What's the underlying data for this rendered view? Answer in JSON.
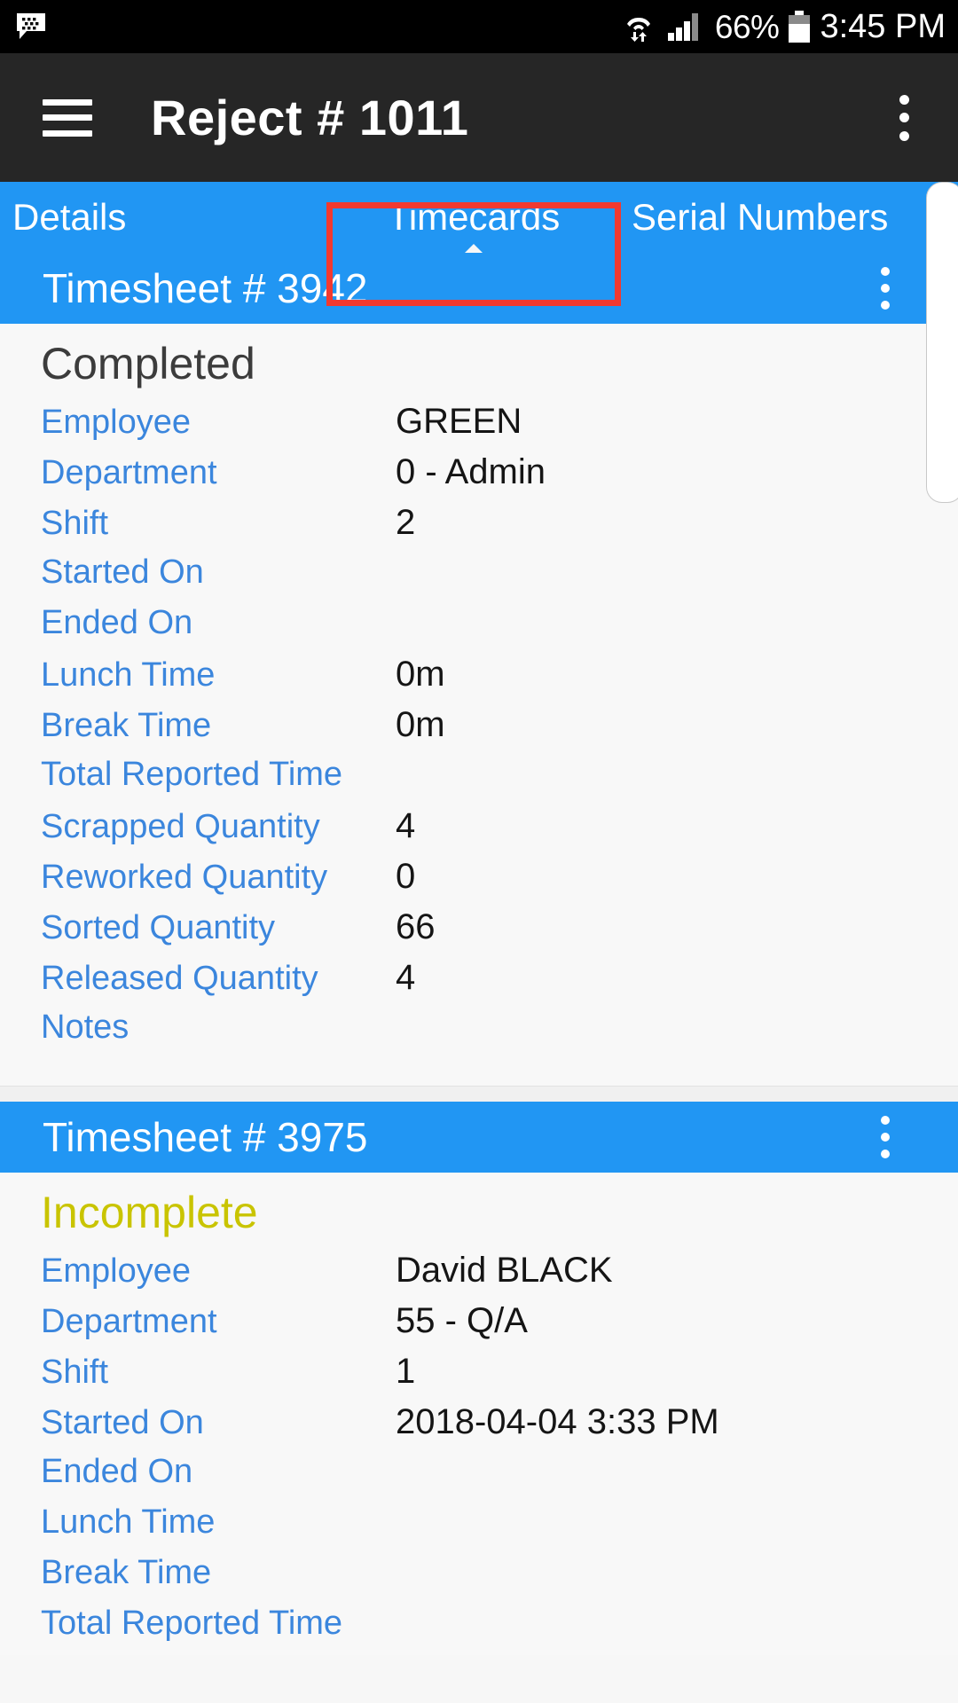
{
  "statusbar": {
    "message_icon": "blackberry-message-icon",
    "wifi_icon": "wifi-transfer-icon",
    "signal_icon": "cellular-signal-icon",
    "battery_percent": "66%",
    "battery_icon": "battery-icon",
    "time": "3:45 PM"
  },
  "appbar": {
    "menu_icon": "hamburger-menu-icon",
    "title": "Reject # 1011",
    "overflow_icon": "overflow-menu-icon"
  },
  "tabs": [
    {
      "label": "Details",
      "active": false
    },
    {
      "label": "Timecards",
      "active": true
    },
    {
      "label": "Serial Numbers",
      "active": false
    }
  ],
  "annotation": {
    "color": "#f2392f",
    "target": "Timecards"
  },
  "colors": {
    "accent_blue": "#2196f3",
    "label_blue": "#3b86dd",
    "status_incomplete": "#c9c400",
    "status_completed": "#3c3c3c",
    "appbar_dark": "#262626"
  },
  "cards": [
    {
      "title": "Timesheet # 3942",
      "overflow_icon": "overflow-menu-icon",
      "status": "Completed",
      "rows": [
        {
          "label": "Employee",
          "value": " GREEN"
        },
        {
          "label": "Department",
          "value": "0 - Admin"
        },
        {
          "label": "Shift",
          "value": "2"
        },
        {
          "label": "Started On",
          "value": ""
        },
        {
          "label": "Ended On",
          "value": ""
        },
        {
          "label": "Lunch Time",
          "value": "0m"
        },
        {
          "label": "Break Time",
          "value": "0m"
        },
        {
          "label": "Total Reported Time",
          "value": ""
        },
        {
          "label": "Scrapped Quantity",
          "value": "4"
        },
        {
          "label": "Reworked Quantity",
          "value": "0"
        },
        {
          "label": "Sorted Quantity",
          "value": "66"
        },
        {
          "label": "Released Quantity",
          "value": "4"
        },
        {
          "label": "Notes",
          "value": ""
        }
      ]
    },
    {
      "title": "Timesheet # 3975",
      "overflow_icon": "overflow-menu-icon",
      "status": "Incomplete",
      "rows": [
        {
          "label": "Employee",
          "value": "David BLACK"
        },
        {
          "label": "Department",
          "value": "55 - Q/A"
        },
        {
          "label": "Shift",
          "value": "1"
        },
        {
          "label": "Started On",
          "value": "2018-04-04 3:33 PM"
        },
        {
          "label": "Ended On",
          "value": ""
        },
        {
          "label": "Lunch Time",
          "value": ""
        },
        {
          "label": "Break Time",
          "value": ""
        },
        {
          "label": "Total Reported Time",
          "value": ""
        }
      ]
    }
  ]
}
